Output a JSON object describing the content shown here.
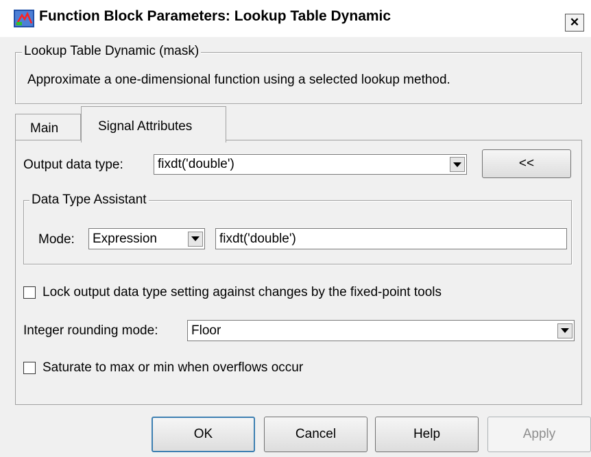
{
  "window": {
    "title": "Function Block Parameters: Lookup Table Dynamic",
    "close_symbol": "✕"
  },
  "mask": {
    "legend": "Lookup Table Dynamic (mask)",
    "description": "Approximate a one-dimensional function using a selected lookup method."
  },
  "tabs": [
    {
      "label": "Main",
      "selected": false
    },
    {
      "label": "Signal Attributes",
      "selected": true
    }
  ],
  "signal_attributes": {
    "output_data_type_label": "Output data type:",
    "output_data_type_value": "fixdt('double')",
    "toggle_assistant_label": "<<",
    "assistant": {
      "legend": "Data Type Assistant",
      "mode_label": "Mode:",
      "mode_value": "Expression",
      "expression_value": "fixdt('double')"
    },
    "lock_checkbox_label": "Lock output data type setting against changes by the fixed-point tools",
    "lock_checked": false,
    "rounding_label": "Integer rounding mode:",
    "rounding_value": "Floor",
    "saturate_checkbox_label": "Saturate to max or min when overflows occur",
    "saturate_checked": false
  },
  "buttons": {
    "ok": "OK",
    "cancel": "Cancel",
    "help": "Help",
    "apply": "Apply"
  }
}
